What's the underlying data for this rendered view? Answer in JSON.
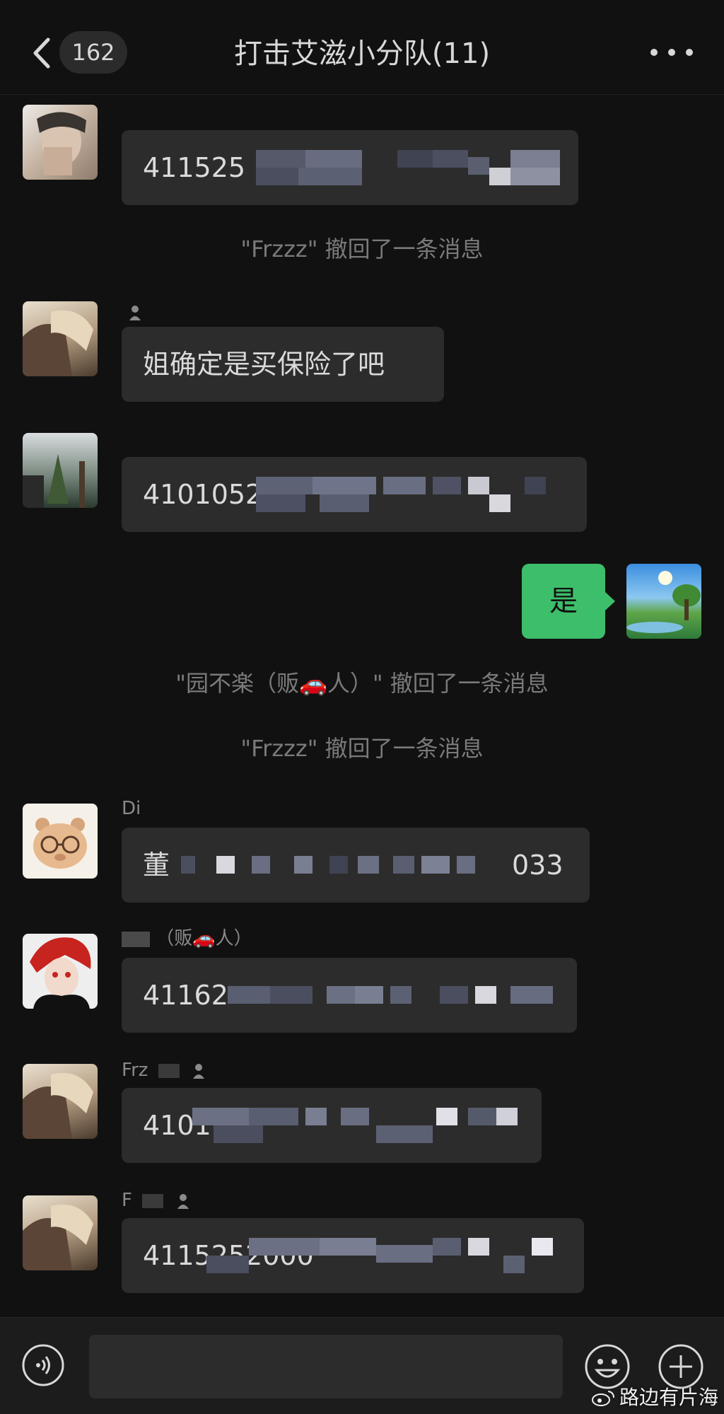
{
  "header": {
    "unread_count": "162",
    "title": "打击艾滋小分队(11)"
  },
  "messages": [
    {
      "sender": "",
      "text": "411525"
    },
    {
      "system": "\"Frzzz\" 撤回了一条消息"
    },
    {
      "sender": "",
      "text": "姐确定是买保险了吧"
    },
    {
      "sender": "",
      "text": "4101052"
    },
    {
      "self_text": "是"
    },
    {
      "system": "\"园不楽（贩🚗人）\" 撤回了一条消息"
    },
    {
      "system": "\"Frzzz\" 撤回了一条消息"
    },
    {
      "sender": "Di",
      "text_start": "董",
      "text_end": "033"
    },
    {
      "sender": "（贩🚗人）",
      "text": "41162"
    },
    {
      "sender": "Frz",
      "text": "4101"
    },
    {
      "sender": "F",
      "text": "4115252000"
    }
  ],
  "watermark": "路边有片海",
  "icons": [
    "back-chevron-icon",
    "more-icon",
    "person-icon",
    "voice-icon",
    "emoji-icon",
    "plus-icon",
    "weibo-logo-icon"
  ],
  "colors": {
    "background": "#111111",
    "bubble": "#2c2c2c",
    "self_bubble": "#3dbe6a"
  }
}
